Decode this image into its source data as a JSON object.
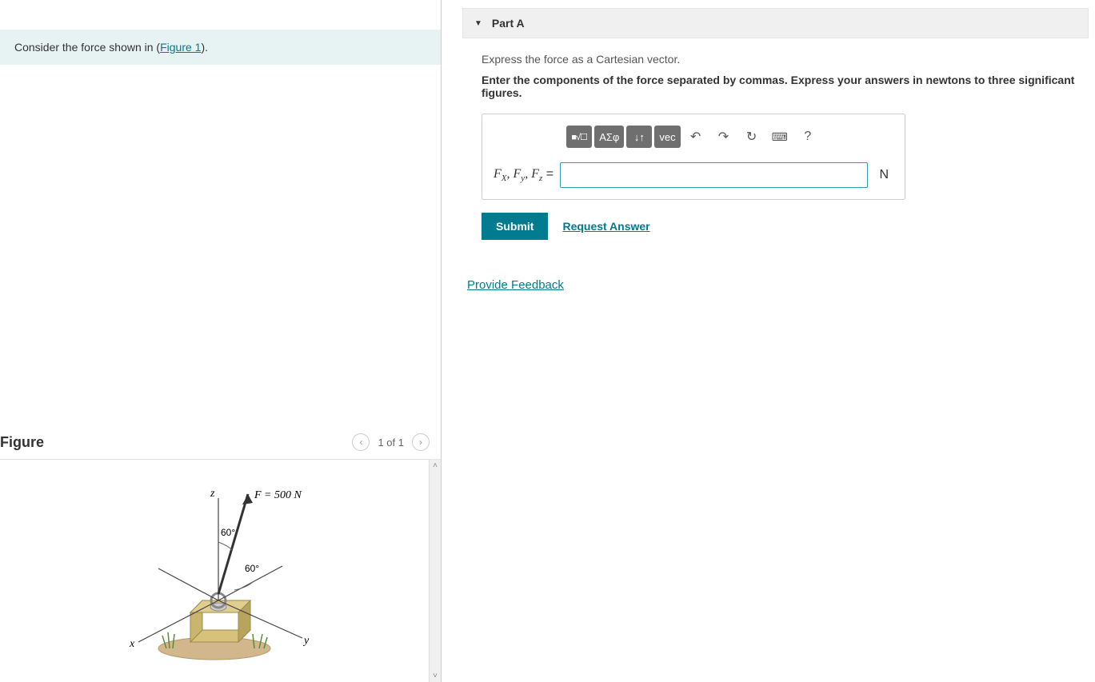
{
  "intro": {
    "text_prefix": "Consider the force shown in (",
    "figure_link": "Figure 1",
    "text_suffix": ")."
  },
  "figure": {
    "title": "Figure",
    "nav_counter": "1 of 1",
    "labels": {
      "z": "z",
      "force": "F = 500 N",
      "angle1": "60°",
      "angle2": "60°",
      "x": "x",
      "y": "y"
    }
  },
  "part": {
    "title": "Part A",
    "instruction1": "Express the force as a Cartesian vector.",
    "instruction2": "Enter the components of the force separated by commas. Express your answers in newtons to three significant figures.",
    "toolbar": {
      "templates_icon": "■√☐",
      "greek": "ΑΣφ",
      "subscript": "↓↑",
      "vec": "vec",
      "undo": "↶",
      "redo": "↷",
      "reset": "↻",
      "keyboard": "⌨",
      "help": "?"
    },
    "vars": {
      "fx": "F",
      "fx_sub": "X",
      "fy": "F",
      "fy_sub": "y",
      "fz": "F",
      "fz_sub": "z",
      "equals": " = "
    },
    "answer_value": "",
    "answer_placeholder": "",
    "unit": "N",
    "submit": "Submit",
    "request_answer": "Request Answer"
  },
  "feedback": {
    "link": "Provide Feedback"
  }
}
